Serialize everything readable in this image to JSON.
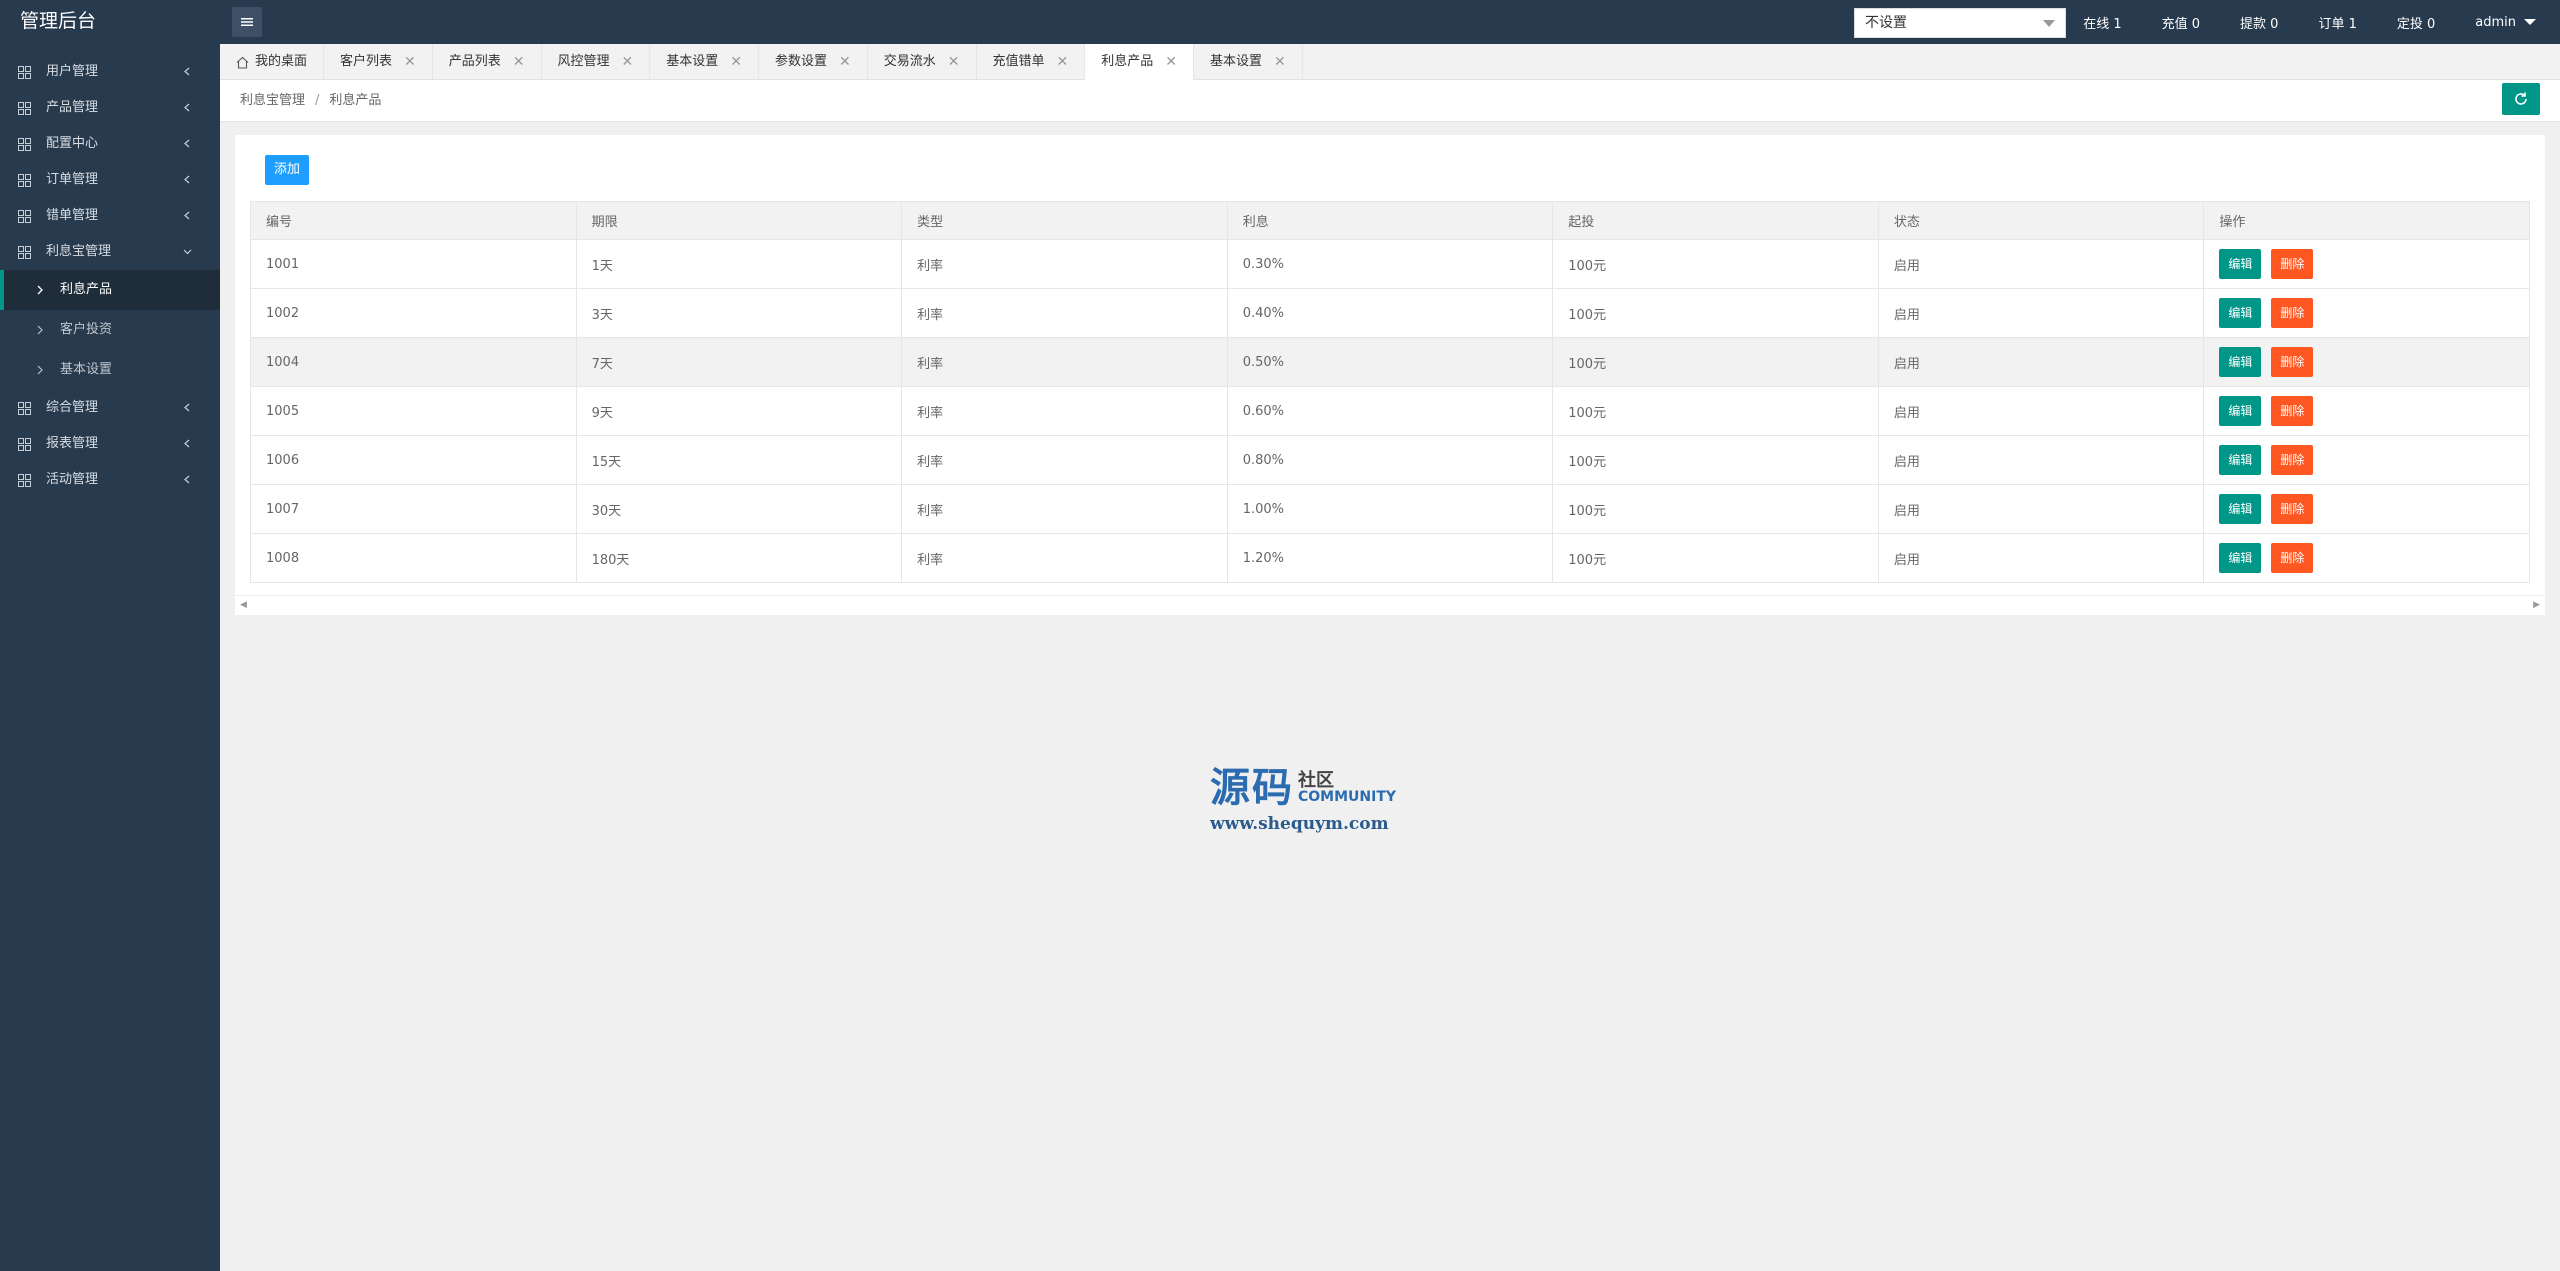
{
  "app": {
    "title": "管理后台"
  },
  "topbar": {
    "site_select": "不设置",
    "stats": [
      "在线 1",
      "充值 0",
      "提款 0",
      "订单 1",
      "定投 0"
    ],
    "user": "admin"
  },
  "sidebar": {
    "items_before": [
      "用户管理",
      "产品管理",
      "配置中心",
      "订单管理",
      "错单管理"
    ],
    "open_group": "利息宝管理",
    "sub_items": [
      "利息产品",
      "客户投资",
      "基本设置"
    ],
    "items_after": [
      "综合管理",
      "报表管理",
      "活动管理"
    ]
  },
  "tabs": [
    "我的桌面",
    "客户列表",
    "产品列表",
    "风控管理",
    "基本设置",
    "参数设置",
    "交易流水",
    "充值错单",
    "利息产品",
    "基本设置"
  ],
  "breadcrumb": [
    "利息宝管理",
    "利息产品"
  ],
  "breadcrumb_sep": "/",
  "toolbar": {
    "add_label": "添加"
  },
  "table": {
    "columns": [
      "编号",
      "期限",
      "类型",
      "利息",
      "起投",
      "状态",
      "操作"
    ],
    "rows": [
      [
        "1001",
        "1天",
        "利率",
        "0.30%",
        "100元",
        "启用"
      ],
      [
        "1002",
        "3天",
        "利率",
        "0.40%",
        "100元",
        "启用"
      ],
      [
        "1004",
        "7天",
        "利率",
        "0.50%",
        "100元",
        "启用"
      ],
      [
        "1005",
        "9天",
        "利率",
        "0.60%",
        "100元",
        "启用"
      ],
      [
        "1006",
        "15天",
        "利率",
        "0.80%",
        "100元",
        "启用"
      ],
      [
        "1007",
        "30天",
        "利率",
        "1.00%",
        "100元",
        "启用"
      ],
      [
        "1008",
        "180天",
        "利率",
        "1.20%",
        "100元",
        "启用"
      ]
    ],
    "edit_label": "编辑",
    "delete_label": "删除"
  },
  "watermark": {
    "big": "源码",
    "small": "社区",
    "community": "COMMUNITY",
    "url": "www.shequym.com"
  },
  "colors": {
    "sidebar_bg": "#283a4d",
    "accent_green": "#009688",
    "add_blue": "#1e9fff",
    "delete_orange": "#ff5722"
  }
}
